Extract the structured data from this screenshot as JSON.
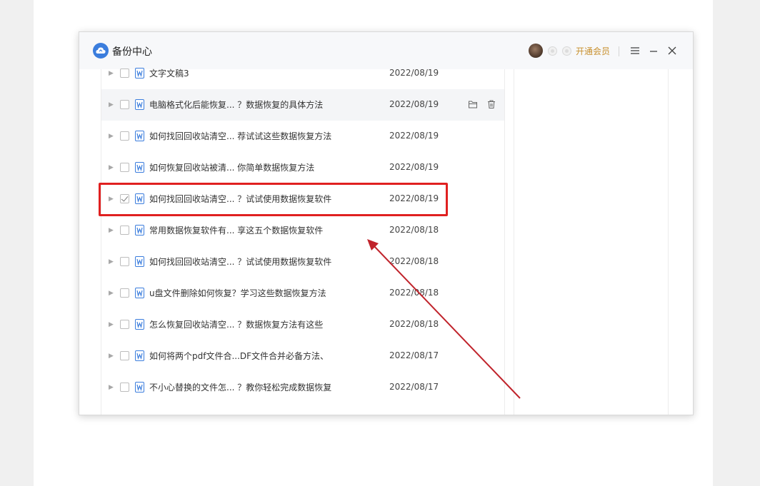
{
  "window": {
    "title": "备份中心",
    "vip_label": "开通会员"
  },
  "files": [
    {
      "name": "文字文稿3",
      "date": "2022/08/19",
      "checked": false
    },
    {
      "name": "电脑格式化后能恢复... ？数据恢复的具体方法",
      "date": "2022/08/19",
      "checked": false,
      "hovered": true
    },
    {
      "name": "如何找回回收站清空... 荐试试这些数据恢复方法",
      "date": "2022/08/19",
      "checked": false
    },
    {
      "name": "如何恢复回收站被清... 你简单数据恢复方法",
      "date": "2022/08/19",
      "checked": false
    },
    {
      "name": "如何找回回收站清空... ？试试使用数据恢复软件",
      "date": "2022/08/19",
      "checked": true
    },
    {
      "name": "常用数据恢复软件有... 享这五个数据恢复软件",
      "date": "2022/08/18",
      "checked": false
    },
    {
      "name": "如何找回回收站清空... ？试试使用数据恢复软件",
      "date": "2022/08/18",
      "checked": false
    },
    {
      "name": "u盘文件删除如何恢复？学习这些数据恢复方法",
      "date": "2022/08/18",
      "checked": false
    },
    {
      "name": "怎么恢复回收站清空... ？数据恢复方法有这些",
      "date": "2022/08/18",
      "checked": false
    },
    {
      "name": "如何将两个pdf文件合...DF文件合并必备方法、",
      "date": "2022/08/17",
      "checked": false
    },
    {
      "name": "不小心替换的文件怎... ？教你轻松完成数据恢复",
      "date": "2022/08/17",
      "checked": false
    }
  ],
  "colors": {
    "accent": "#3b7ddd",
    "vip": "#c8902e",
    "highlight": "#e02020",
    "doc_icon": "#3b7ddd"
  },
  "icons": {
    "logo": "cloud-backup-icon",
    "menu": "hamburger-menu-icon",
    "minimize": "minimize-icon",
    "close": "close-icon",
    "folder": "folder-icon",
    "trash": "trash-icon",
    "document": "word-document-icon",
    "expand": "caret-right-icon"
  }
}
